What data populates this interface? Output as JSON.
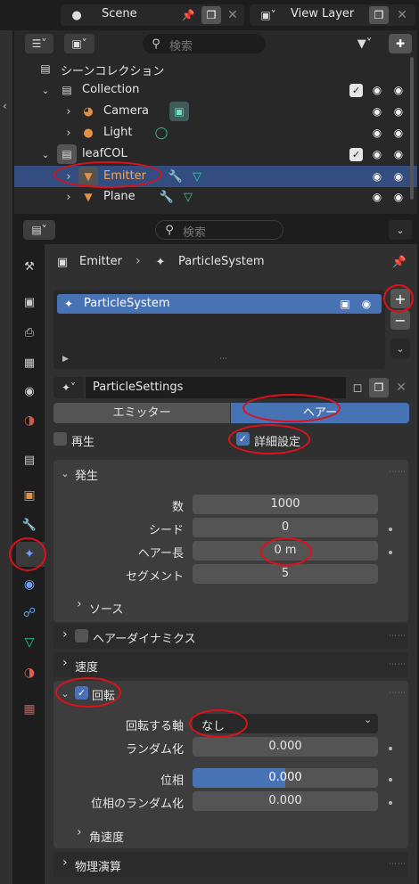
{
  "topbar": {
    "scene_label": "Scene",
    "view_layer_label": "View Layer"
  },
  "outliner": {
    "search_placeholder": "検索",
    "scene_collection": "シーンコレクション",
    "items": [
      {
        "label": "Collection"
      },
      {
        "label": "Camera"
      },
      {
        "label": "Light"
      },
      {
        "label": "leafCOL"
      },
      {
        "label": "Emitter"
      },
      {
        "label": "Plane"
      }
    ]
  },
  "properties": {
    "search_placeholder": "検索",
    "breadcrumb": {
      "object": "Emitter",
      "system": "ParticleSystem"
    },
    "list_item": "ParticleSystem",
    "settings_name": "ParticleSettings",
    "type_tabs": [
      "エミッター",
      "ヘアー"
    ],
    "playback_label": "再生",
    "advanced_label": "詳細設定",
    "emission": {
      "header": "発生",
      "rows": [
        {
          "label": "数",
          "value": "1000"
        },
        {
          "label": "シード",
          "value": "0"
        },
        {
          "label": "ヘアー長",
          "value": "0 m"
        },
        {
          "label": "セグメント",
          "value": "5"
        }
      ],
      "source": "ソース"
    },
    "hair_dynamics": "ヘアーダイナミクス",
    "velocity": "速度",
    "rotation": {
      "header": "回転",
      "axis_label": "回転する軸",
      "axis_value": "なし",
      "randomize_label": "ランダム化",
      "randomize_value": "0.000",
      "phase_label": "位相",
      "phase_value": "0.000",
      "phase_fraction": 0.5,
      "phase_random_label": "位相のランダム化",
      "phase_random_value": "0.000",
      "angular_velocity": "角速度"
    },
    "physics": "物理演算"
  },
  "colors": {
    "accent": "#4772b3",
    "selected_row": "#334d80",
    "annotation": "#e0101a"
  }
}
